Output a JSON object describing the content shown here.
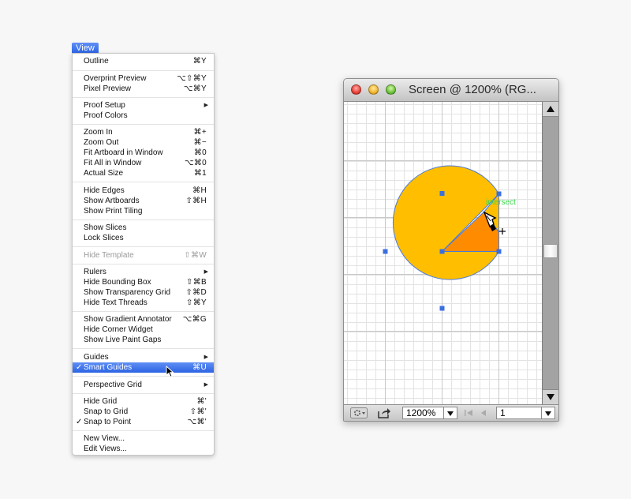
{
  "menu": {
    "title": "View",
    "items": [
      {
        "label": "Outline",
        "shortcut": "⌘Y"
      },
      {
        "label": "Overprint Preview",
        "shortcut": "⌥⇧⌘Y"
      },
      {
        "label": "Pixel Preview",
        "shortcut": "⌥⌘Y"
      },
      {
        "label": "Proof Setup",
        "shortcut": ""
      },
      {
        "label": "Proof Colors",
        "shortcut": ""
      },
      {
        "label": "Zoom In",
        "shortcut": "⌘+"
      },
      {
        "label": "Zoom Out",
        "shortcut": "⌘−"
      },
      {
        "label": "Fit Artboard in Window",
        "shortcut": "⌘0"
      },
      {
        "label": "Fit All in Window",
        "shortcut": "⌥⌘0"
      },
      {
        "label": "Actual Size",
        "shortcut": "⌘1"
      },
      {
        "label": "Hide Edges",
        "shortcut": "⌘H"
      },
      {
        "label": "Show Artboards",
        "shortcut": "⇧⌘H"
      },
      {
        "label": "Show Print Tiling",
        "shortcut": ""
      },
      {
        "label": "Show Slices",
        "shortcut": ""
      },
      {
        "label": "Lock Slices",
        "shortcut": ""
      },
      {
        "label": "Hide Template",
        "shortcut": "⇧⌘W"
      },
      {
        "label": "Rulers",
        "shortcut": ""
      },
      {
        "label": "Hide Bounding Box",
        "shortcut": "⇧⌘B"
      },
      {
        "label": "Show Transparency Grid",
        "shortcut": "⇧⌘D"
      },
      {
        "label": "Hide Text Threads",
        "shortcut": "⇧⌘Y"
      },
      {
        "label": "Show Gradient Annotator",
        "shortcut": "⌥⌘G"
      },
      {
        "label": "Hide Corner Widget",
        "shortcut": ""
      },
      {
        "label": "Show Live Paint Gaps",
        "shortcut": ""
      },
      {
        "label": "Guides",
        "shortcut": ""
      },
      {
        "label": "Smart Guides",
        "shortcut": "⌘U"
      },
      {
        "label": "Perspective Grid",
        "shortcut": ""
      },
      {
        "label": "Hide Grid",
        "shortcut": "⌘'"
      },
      {
        "label": "Snap to Grid",
        "shortcut": "⇧⌘'"
      },
      {
        "label": "Snap to Point",
        "shortcut": "⌥⌘'"
      },
      {
        "label": "New View...",
        "shortcut": ""
      },
      {
        "label": "Edit Views...",
        "shortcut": ""
      }
    ],
    "checkmark": "✓",
    "submenu_arrow": "▶"
  },
  "window": {
    "title": "Screen @ 1200% (RG...",
    "zoom": "1200%",
    "page": "1",
    "smart_guide_label": "intersect"
  },
  "colors": {
    "highlight": "#2c63e3",
    "shape_fill": "#ffbf00",
    "slice_fill": "#ff8c00",
    "anchor": "#3b6fe0",
    "smart_guide": "#39d84a"
  },
  "icons": {
    "cursor": "arrow-cursor-icon",
    "pen_tool": "pen-tool-icon",
    "gear": "gear-icon",
    "share": "share-icon"
  }
}
